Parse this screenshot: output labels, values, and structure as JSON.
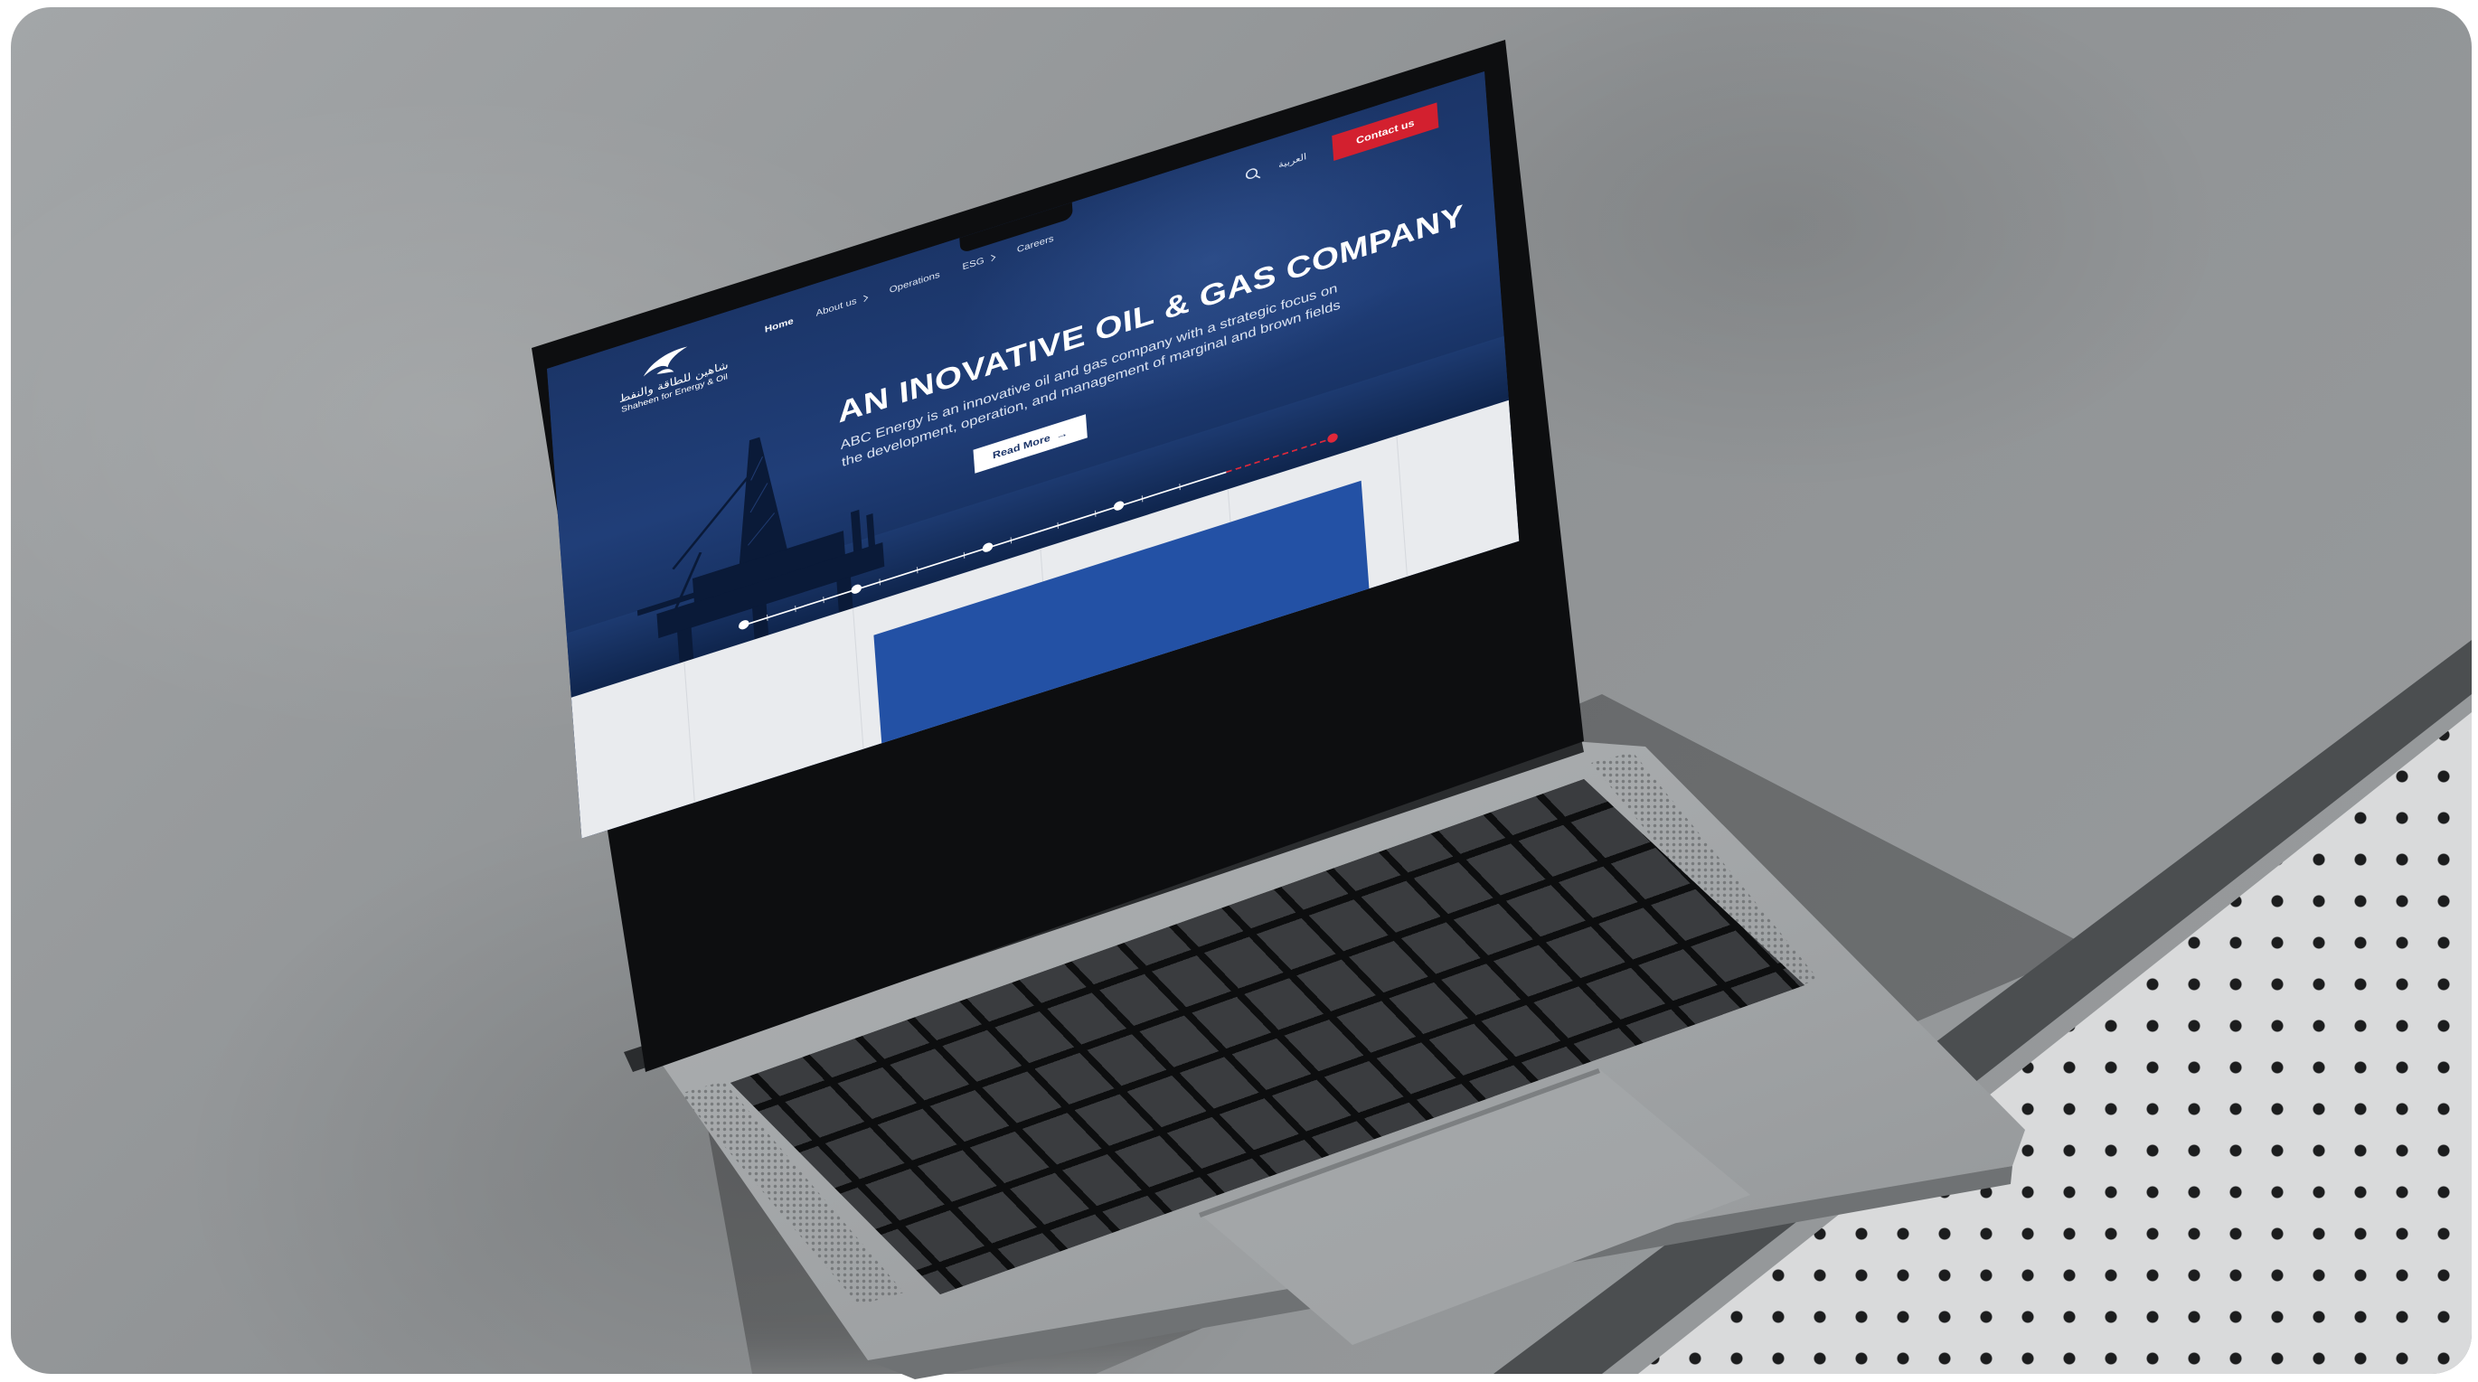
{
  "brand": {
    "name_ar": "شاهين للطاقة والنفط",
    "name_en": "Shaheen for Energy & Oil"
  },
  "nav": {
    "items": [
      {
        "label": "Home",
        "active": true,
        "has_submenu": false
      },
      {
        "label": "About us",
        "active": false,
        "has_submenu": true
      },
      {
        "label": "Operations",
        "active": false,
        "has_submenu": false
      },
      {
        "label": "ESG",
        "active": false,
        "has_submenu": true
      },
      {
        "label": "Careers",
        "active": false,
        "has_submenu": false
      }
    ],
    "language_toggle": "العربية",
    "contact_label": "Contact us",
    "search_icon": "search-icon"
  },
  "hero": {
    "title": "AN INOVATIVE OIL & GAS COMPANY",
    "subtitle_line1": "ABC Energy is an innovative oil and gas company with a strategic focus on",
    "subtitle_line2": "the development, operation, and management of marginal and brown fields",
    "cta_label": "Read More",
    "cta_icon": "arrow-right-icon"
  },
  "colors": {
    "navy": "#1b3468",
    "accent_red": "#d3202f",
    "card_blue": "#2351a5"
  }
}
